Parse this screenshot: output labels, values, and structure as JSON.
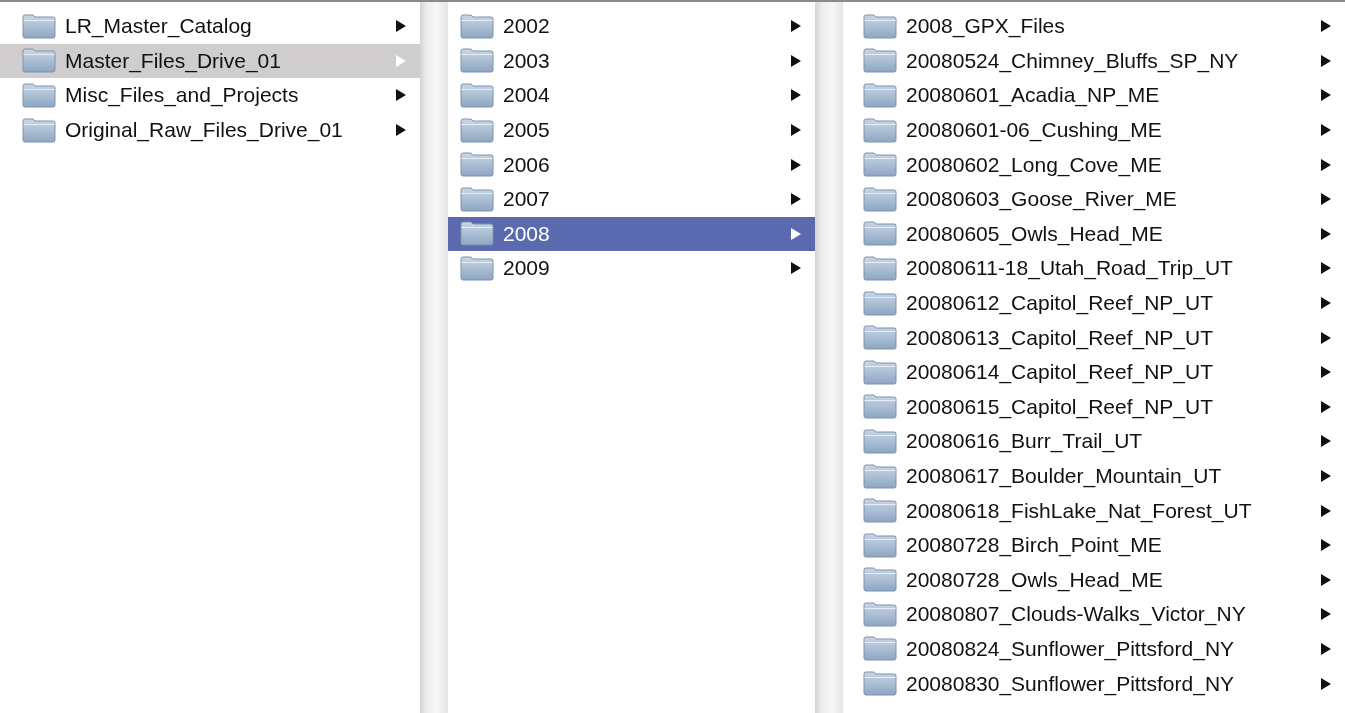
{
  "columns": [
    {
      "focused": false,
      "items": [
        {
          "name": "LR_Master_Catalog",
          "selected": false
        },
        {
          "name": "Master_Files_Drive_01",
          "selected": true
        },
        {
          "name": "Misc_Files_and_Projects",
          "selected": false
        },
        {
          "name": "Original_Raw_Files_Drive_01",
          "selected": false
        }
      ]
    },
    {
      "focused": true,
      "items": [
        {
          "name": "2002",
          "selected": false
        },
        {
          "name": "2003",
          "selected": false
        },
        {
          "name": "2004",
          "selected": false
        },
        {
          "name": "2005",
          "selected": false
        },
        {
          "name": "2006",
          "selected": false
        },
        {
          "name": "2007",
          "selected": false
        },
        {
          "name": "2008",
          "selected": true
        },
        {
          "name": "2009",
          "selected": false
        }
      ]
    },
    {
      "items": [
        {
          "name": "2008_GPX_Files",
          "selected": false
        },
        {
          "name": "20080524_Chimney_Bluffs_SP_NY",
          "selected": false
        },
        {
          "name": "20080601_Acadia_NP_ME",
          "selected": false
        },
        {
          "name": "20080601-06_Cushing_ME",
          "selected": false
        },
        {
          "name": "20080602_Long_Cove_ME",
          "selected": false
        },
        {
          "name": "20080603_Goose_River_ME",
          "selected": false
        },
        {
          "name": "20080605_Owls_Head_ME",
          "selected": false
        },
        {
          "name": "20080611-18_Utah_Road_Trip_UT",
          "selected": false
        },
        {
          "name": "20080612_Capitol_Reef_NP_UT",
          "selected": false
        },
        {
          "name": "20080613_Capitol_Reef_NP_UT",
          "selected": false
        },
        {
          "name": "20080614_Capitol_Reef_NP_UT",
          "selected": false
        },
        {
          "name": "20080615_Capitol_Reef_NP_UT",
          "selected": false
        },
        {
          "name": "20080616_Burr_Trail_UT",
          "selected": false
        },
        {
          "name": "20080617_Boulder_Mountain_UT",
          "selected": false
        },
        {
          "name": "20080618_FishLake_Nat_Forest_UT",
          "selected": false
        },
        {
          "name": "20080728_Birch_Point_ME",
          "selected": false
        },
        {
          "name": "20080728_Owls_Head_ME",
          "selected": false
        },
        {
          "name": "20080807_Clouds-Walks_Victor_NY",
          "selected": false
        },
        {
          "name": "20080824_Sunflower_Pittsford_NY",
          "selected": false
        },
        {
          "name": "20080830_Sunflower_Pittsford_NY",
          "selected": false
        }
      ]
    }
  ]
}
